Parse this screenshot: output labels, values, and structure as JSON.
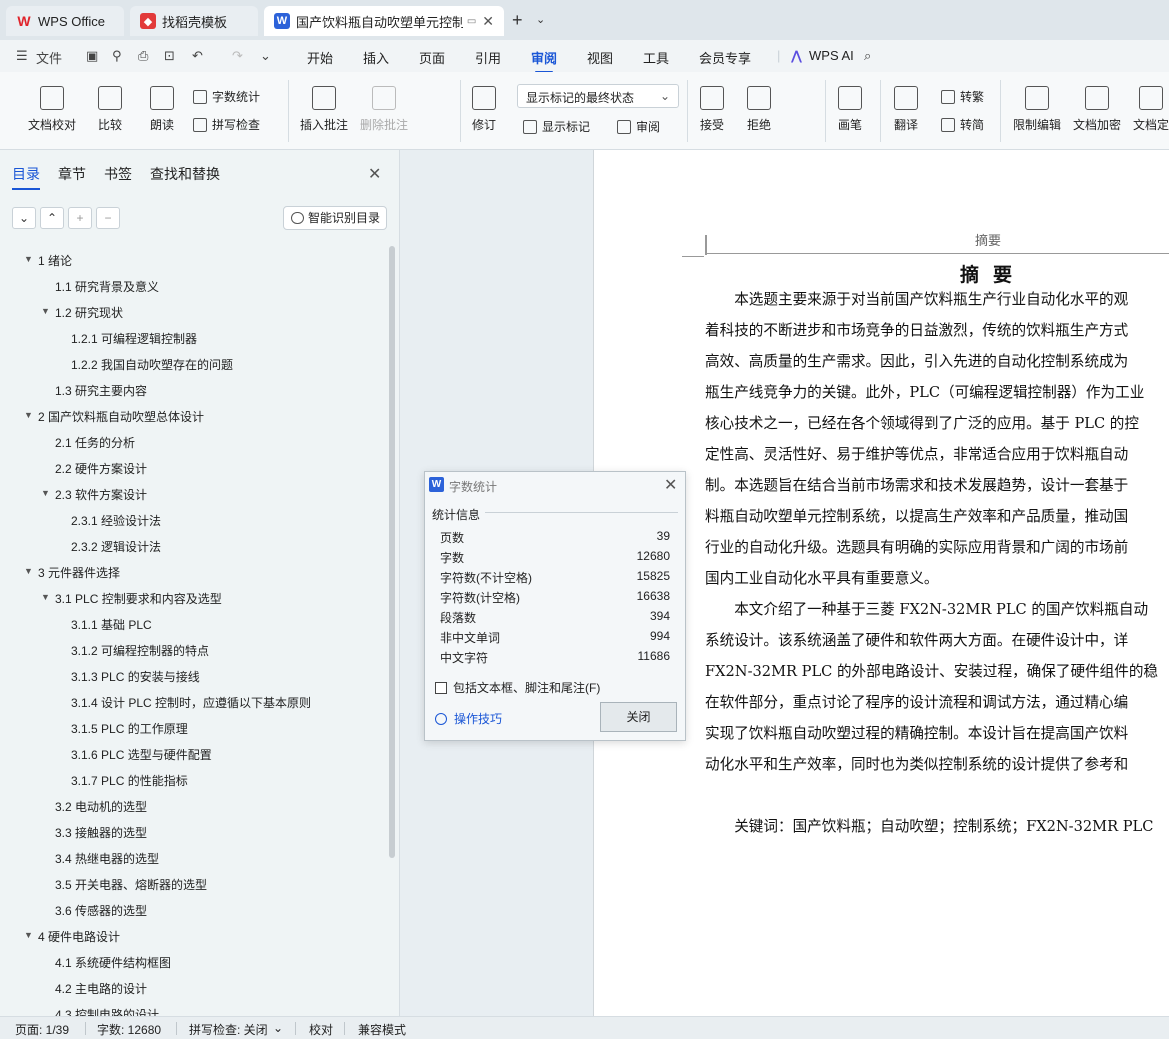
{
  "tabs": [
    {
      "label": "WPS Office"
    },
    {
      "label": "找稻壳模板"
    },
    {
      "label": "国产饮料瓶自动吹塑单元控制系"
    }
  ],
  "new_tab": "+",
  "menu": {
    "file": "文件",
    "items": [
      "开始",
      "插入",
      "页面",
      "引用",
      "审阅",
      "视图",
      "工具",
      "会员专享"
    ],
    "active": "审阅",
    "ai": "WPS AI"
  },
  "ribbon": {
    "doc_proof": "文档校对",
    "compare": "比较",
    "read_aloud": "朗读",
    "word_count": "字数统计",
    "spell_check": "拼写检查",
    "insert_comment": "插入批注",
    "delete_comment": "删除批注",
    "revise": "修订",
    "markup_state": "显示标记的最终状态",
    "show_markup": "显示标记",
    "review": "审阅",
    "accept": "接受",
    "reject": "拒绝",
    "pen": "画笔",
    "translate": "翻译",
    "to_traditional": "转繁",
    "to_simplified": "转简",
    "restrict_edit": "限制编辑",
    "encrypt": "文档加密",
    "finalize": "文档定"
  },
  "nav": {
    "tabs": [
      "目录",
      "章节",
      "书签",
      "查找和替换"
    ],
    "smart_btn": "智能识别目录",
    "toc": [
      {
        "label": "1  绪论",
        "level": 1,
        "collapsible": true
      },
      {
        "label": "1.1 研究背景及意义",
        "level": 2,
        "collapsible": false
      },
      {
        "label": "1.2 研究现状",
        "level": 2,
        "collapsible": true
      },
      {
        "label": "1.2.1  可编程逻辑控制器",
        "level": 3,
        "collapsible": false
      },
      {
        "label": "1.2.2  我国自动吹塑存在的问题",
        "level": 3,
        "collapsible": false
      },
      {
        "label": "1.3 研究主要内容",
        "level": 2,
        "collapsible": false
      },
      {
        "label": "2  国产饮料瓶自动吹塑总体设计",
        "level": 1,
        "collapsible": true
      },
      {
        "label": "2.1 任务的分析",
        "level": 2,
        "collapsible": false
      },
      {
        "label": "2.2 硬件方案设计",
        "level": 2,
        "collapsible": false
      },
      {
        "label": "2.3 软件方案设计",
        "level": 2,
        "collapsible": true
      },
      {
        "label": "2.3.1 经验设计法",
        "level": 3,
        "collapsible": false
      },
      {
        "label": "2.3.2 逻辑设计法",
        "level": 3,
        "collapsible": false
      },
      {
        "label": "3  元件器件选择",
        "level": 1,
        "collapsible": true
      },
      {
        "label": "3.1 PLC 控制要求和内容及选型",
        "level": 2,
        "collapsible": true
      },
      {
        "label": "3.1.1 基础 PLC",
        "level": 3,
        "collapsible": false
      },
      {
        "label": "3.1.2 可编程控制器的特点",
        "level": 3,
        "collapsible": false
      },
      {
        "label": "3.1.3 PLC 的安装与接线",
        "level": 3,
        "collapsible": false
      },
      {
        "label": "3.1.4 设计 PLC 控制时，应遵循以下基本原则",
        "level": 3,
        "collapsible": false
      },
      {
        "label": "3.1.5 PLC 的工作原理",
        "level": 3,
        "collapsible": false
      },
      {
        "label": "3.1.6 PLC 选型与硬件配置",
        "level": 3,
        "collapsible": false
      },
      {
        "label": "3.1.7 PLC 的性能指标",
        "level": 3,
        "collapsible": false
      },
      {
        "label": "3.2 电动机的选型",
        "level": 2,
        "collapsible": false
      },
      {
        "label": "3.3 接触器的选型",
        "level": 2,
        "collapsible": false
      },
      {
        "label": "3.4 热继电器的选型",
        "level": 2,
        "collapsible": false
      },
      {
        "label": "3.5 开关电器、熔断器的选型",
        "level": 2,
        "collapsible": false
      },
      {
        "label": "3.6 传感器的选型",
        "level": 2,
        "collapsible": false
      },
      {
        "label": "4  硬件电路设计",
        "level": 1,
        "collapsible": true
      },
      {
        "label": "4.1 系统硬件结构框图",
        "level": 2,
        "collapsible": false
      },
      {
        "label": "4.2 主电路的设计",
        "level": 2,
        "collapsible": false
      },
      {
        "label": "4.3 控制电路的设计",
        "level": 2,
        "collapsible": false
      }
    ]
  },
  "document": {
    "header": "摘要",
    "title": "摘要",
    "lines": [
      "　　本选题主要来源于对当前国产饮料瓶生产行业自动化水平的观",
      "着科技的不断进步和市场竞争的日益激烈，传统的饮料瓶生产方式",
      "高效、高质量的生产需求。因此，引入先进的自动化控制系统成为",
      "瓶生产线竞争力的关键。此外，PLC（可编程逻辑控制器）作为工业",
      "核心技术之一，已经在各个领域得到了广泛的应用。基于 PLC 的控",
      "定性高、灵活性好、易于维护等优点，非常适合应用于饮料瓶自动",
      "制。本选题旨在结合当前市场需求和技术发展趋势，设计一套基于",
      "料瓶自动吹塑单元控制系统，以提高生产效率和产品质量，推动国",
      "行业的自动化升级。选题具有明确的实际应用背景和广阔的市场前",
      "国内工业自动化水平具有重要意义。",
      "　　本文介绍了一种基于三菱 FX2N-32MR PLC 的国产饮料瓶自动",
      "系统设计。该系统涵盖了硬件和软件两大方面。在硬件设计中，详",
      "FX2N-32MR PLC 的外部电路设计、安装过程，确保了硬件组件的稳",
      "在软件部分，重点讨论了程序的设计流程和调试方法，通过精心编",
      "实现了饮料瓶自动吹塑过程的精确控制。本设计旨在提高国产饮料",
      "动化水平和生产效率，同时也为类似控制系统的设计提供了参考和"
    ],
    "keywords": "　　关键词：国产饮料瓶；自动吹塑；控制系统；FX2N-32MR PLC"
  },
  "dialog": {
    "title": "字数统计",
    "section": "统计信息",
    "stats": [
      {
        "label": "页数",
        "value": "39"
      },
      {
        "label": "字数",
        "value": "12680"
      },
      {
        "label": "字符数(不计空格)",
        "value": "15825"
      },
      {
        "label": "字符数(计空格)",
        "value": "16638"
      },
      {
        "label": "段落数",
        "value": "394"
      },
      {
        "label": "非中文单词",
        "value": "994"
      },
      {
        "label": "中文字符",
        "value": "11686"
      }
    ],
    "include_label": "包括文本框、脚注和尾注(F)",
    "tips": "操作技巧",
    "close": "关闭"
  },
  "status": {
    "page": "页面: 1/39",
    "words": "字数: 12680",
    "spell": "拼写检查: 关闭",
    "proof": "校对",
    "compat": "兼容模式"
  },
  "colors": {
    "accent": "#1a56d6",
    "wps_red": "#e0242b"
  }
}
